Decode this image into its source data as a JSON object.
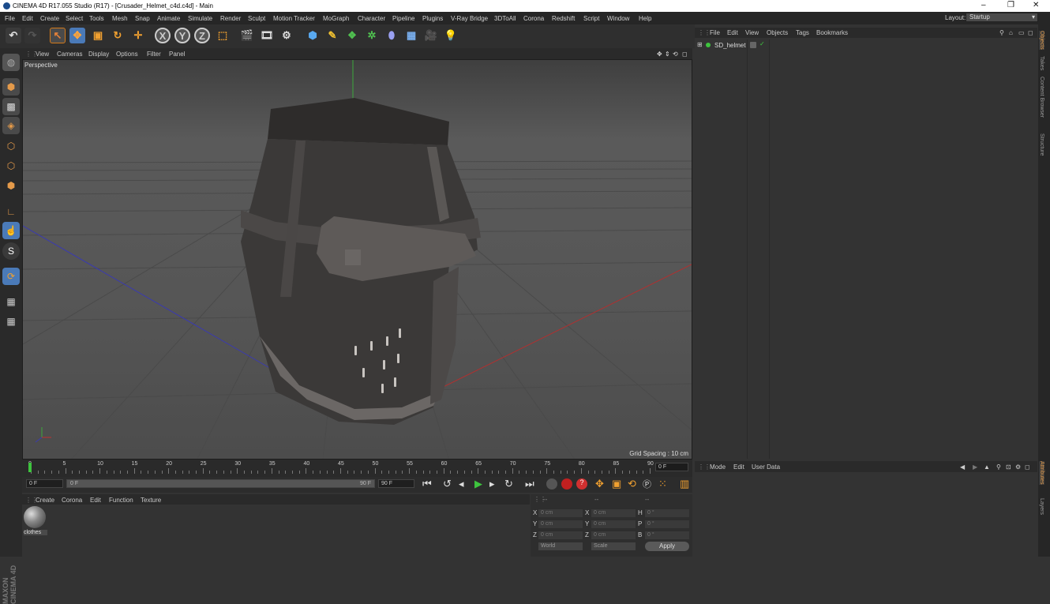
{
  "window": {
    "title": "CINEMA 4D R17.055 Studio (R17) - [Crusader_Helmet_c4d.c4d] - Main",
    "controls": [
      "–",
      "❐",
      "✕"
    ]
  },
  "menubar": {
    "items": [
      "File",
      "Edit",
      "Create",
      "Select",
      "Tools",
      "Mesh",
      "Snap",
      "Animate",
      "Simulate",
      "Render",
      "Sculpt",
      "Motion Tracker",
      "MoGraph",
      "Character",
      "Pipeline",
      "Plugins",
      "V-Ray Bridge",
      "3DToAll",
      "Corona",
      "Redshift",
      "Script",
      "Window",
      "Help"
    ],
    "layout_label": "Layout:",
    "layout_value": "Startup"
  },
  "toolbar": {
    "axis_x": "X",
    "axis_y": "Y",
    "axis_z": "Z"
  },
  "viewport": {
    "menu": [
      "View",
      "Cameras",
      "Display",
      "Options",
      "Filter",
      "Panel"
    ],
    "camera_label": "Perspective",
    "grid_spacing": "Grid Spacing : 10 cm"
  },
  "timeline": {
    "ticks": [
      "0",
      "5",
      "10",
      "15",
      "20",
      "25",
      "30",
      "35",
      "40",
      "45",
      "50",
      "55",
      "60",
      "65",
      "70",
      "75",
      "80",
      "85",
      "90"
    ],
    "current_frame": "0 F"
  },
  "transport": {
    "start_field": "0 F",
    "range_start": "0 F",
    "range_end": "90 F",
    "end_field": "90 F"
  },
  "material_manager": {
    "menu": [
      "Create",
      "Corona",
      "Edit",
      "Function",
      "Texture"
    ],
    "material_name": "clothes"
  },
  "coordinates": {
    "header": [
      "--",
      "--",
      "--"
    ],
    "rows": [
      {
        "axis": "X",
        "pos": "0 cm",
        "axis2": "X",
        "size": "0 cm",
        "rot_label": "H",
        "rot": "0 °"
      },
      {
        "axis": "Y",
        "pos": "0 cm",
        "axis2": "Y",
        "size": "0 cm",
        "rot_label": "P",
        "rot": "0 °"
      },
      {
        "axis": "Z",
        "pos": "0 cm",
        "axis2": "Z",
        "size": "0 cm",
        "rot_label": "B",
        "rot": "0 °"
      }
    ],
    "mode_select": "World",
    "scale_select": "Scale",
    "apply_label": "Apply"
  },
  "object_manager": {
    "menu": [
      "File",
      "Edit",
      "View",
      "Objects",
      "Tags",
      "Bookmarks"
    ],
    "object_name": "SD_helmet"
  },
  "attribute_manager": {
    "menu": [
      "Mode",
      "Edit",
      "User Data"
    ]
  },
  "right_tabs": [
    "Objects",
    "Takes",
    "Content Browser",
    "Structure",
    "Attributes",
    "Layers"
  ],
  "branding": "MAXON CINEMA 4D"
}
